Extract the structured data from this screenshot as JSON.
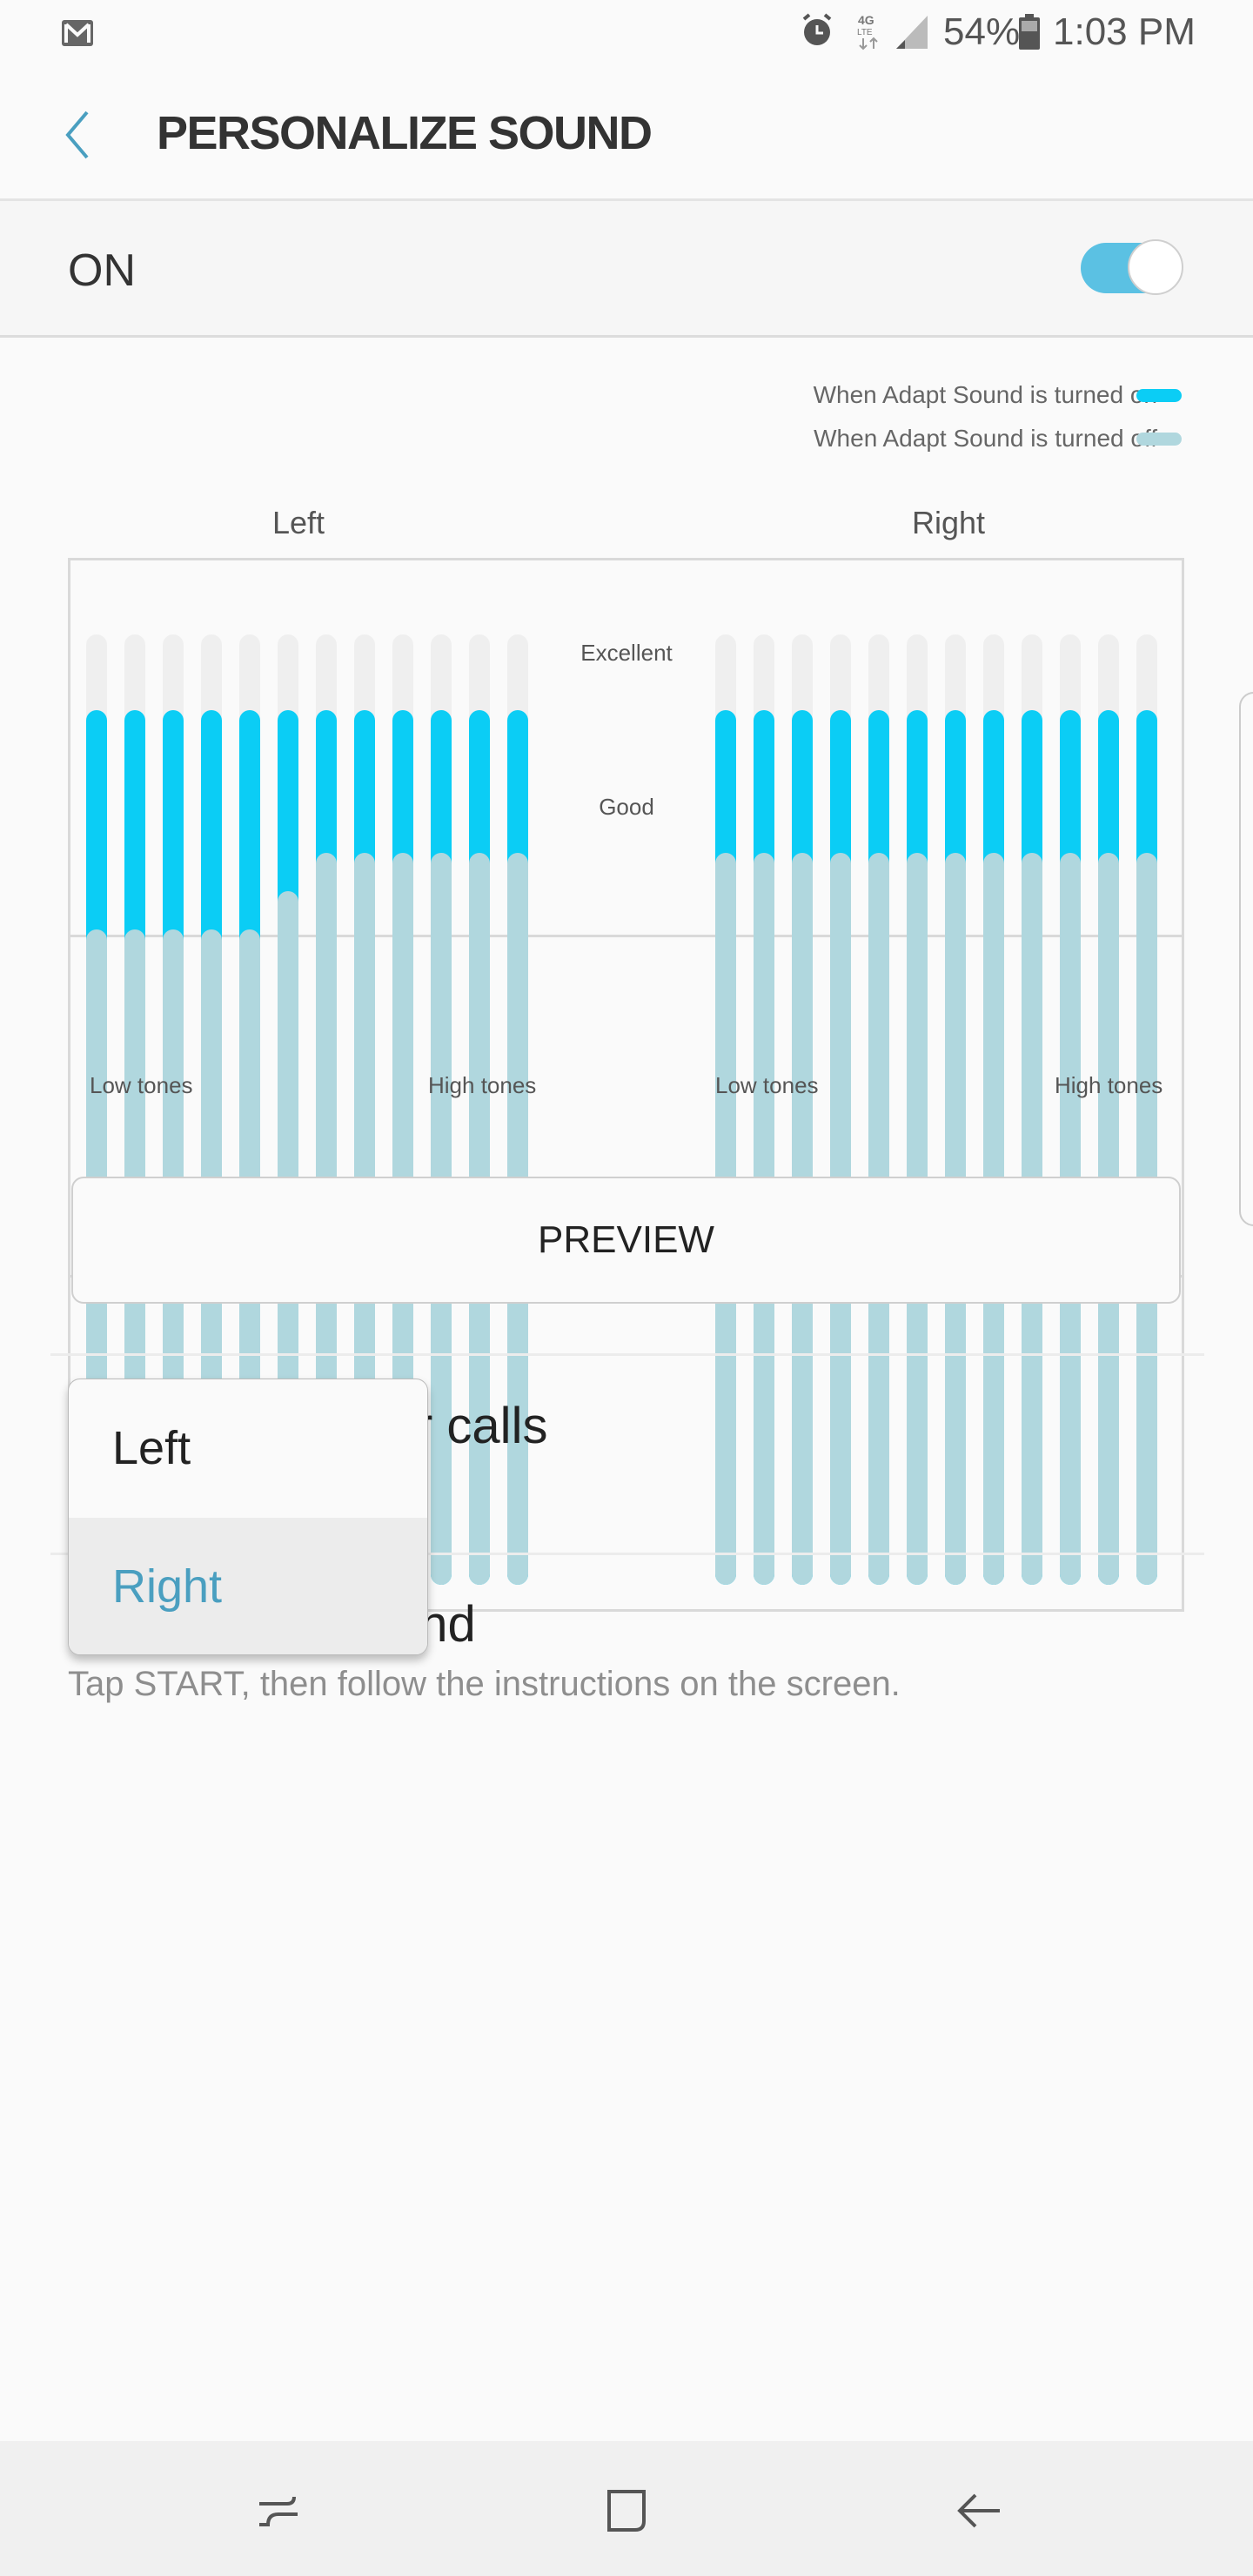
{
  "status_bar": {
    "battery": "54%",
    "time": "1:03 PM",
    "icons": [
      "gmail-icon",
      "alarm-icon",
      "4g-lte-icon",
      "signal-icon",
      "battery-icon"
    ]
  },
  "header": {
    "title": "PERSONALIZE SOUND",
    "back_icon": "back-chevron-icon"
  },
  "master_switch": {
    "label": "ON",
    "on": true
  },
  "legend": {
    "on_label": "When Adapt Sound is turned on",
    "off_label": "When Adapt Sound is turned off"
  },
  "colors": {
    "adapt_on": "#0bcdf5",
    "adapt_off": "#b0d7de",
    "track": "#efefef",
    "accent": "#4a9fc0",
    "toggle": "#5bc1e3"
  },
  "chart_data": {
    "type": "bar",
    "panels": [
      {
        "title": "Left",
        "x_start_label": "Low tones",
        "x_end_label": "High tones",
        "adapt_on": [
          0.92,
          0.92,
          0.92,
          0.92,
          0.92,
          0.92,
          0.92,
          0.92,
          0.92,
          0.92,
          0.92,
          0.92
        ],
        "adapt_off": [
          0.69,
          0.69,
          0.69,
          0.69,
          0.69,
          0.73,
          0.77,
          0.77,
          0.77,
          0.77,
          0.77,
          0.77
        ]
      },
      {
        "title": "Right",
        "x_start_label": "Low tones",
        "x_end_label": "High tones",
        "adapt_on": [
          0.92,
          0.92,
          0.92,
          0.92,
          0.92,
          0.92,
          0.92,
          0.92,
          0.92,
          0.92,
          0.92,
          0.92
        ],
        "adapt_off": [
          0.77,
          0.77,
          0.77,
          0.77,
          0.77,
          0.77,
          0.77,
          0.77,
          0.77,
          0.77,
          0.77,
          0.77
        ]
      }
    ],
    "zones": [
      "Excellent",
      "Good"
    ],
    "ylim": [
      0,
      1
    ]
  },
  "preview_label": "PREVIEW",
  "items": [
    {
      "title_visible": "r calls"
    },
    {
      "title_visible": "und",
      "subtitle": "Tap START, then follow the instructions on the screen."
    }
  ],
  "popup": {
    "options": [
      "Left",
      "Right"
    ],
    "selected": "Right"
  },
  "navbar": {
    "icons": [
      "recents-icon",
      "home-icon",
      "back-icon"
    ]
  }
}
